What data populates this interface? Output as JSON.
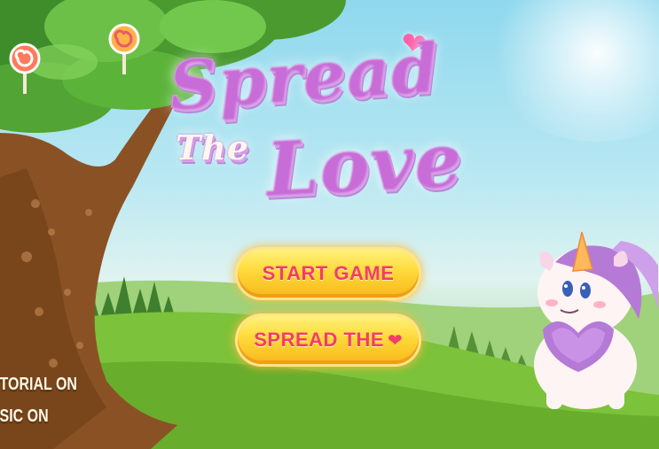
{
  "title": {
    "line1": "Spread",
    "line2": "The",
    "line3": "Love"
  },
  "menu": {
    "start_label": "START GAME",
    "spread_label": "SPREAD THE",
    "spread_icon": "heart-icon"
  },
  "options": {
    "tutorial_label": "UTORIAL ON",
    "music_label": "USIC ON"
  },
  "colors": {
    "button_text": "#f23c6c",
    "button_fill": "#ffd93a",
    "sky": "#8fd8ee",
    "grass": "#7cc23a"
  }
}
